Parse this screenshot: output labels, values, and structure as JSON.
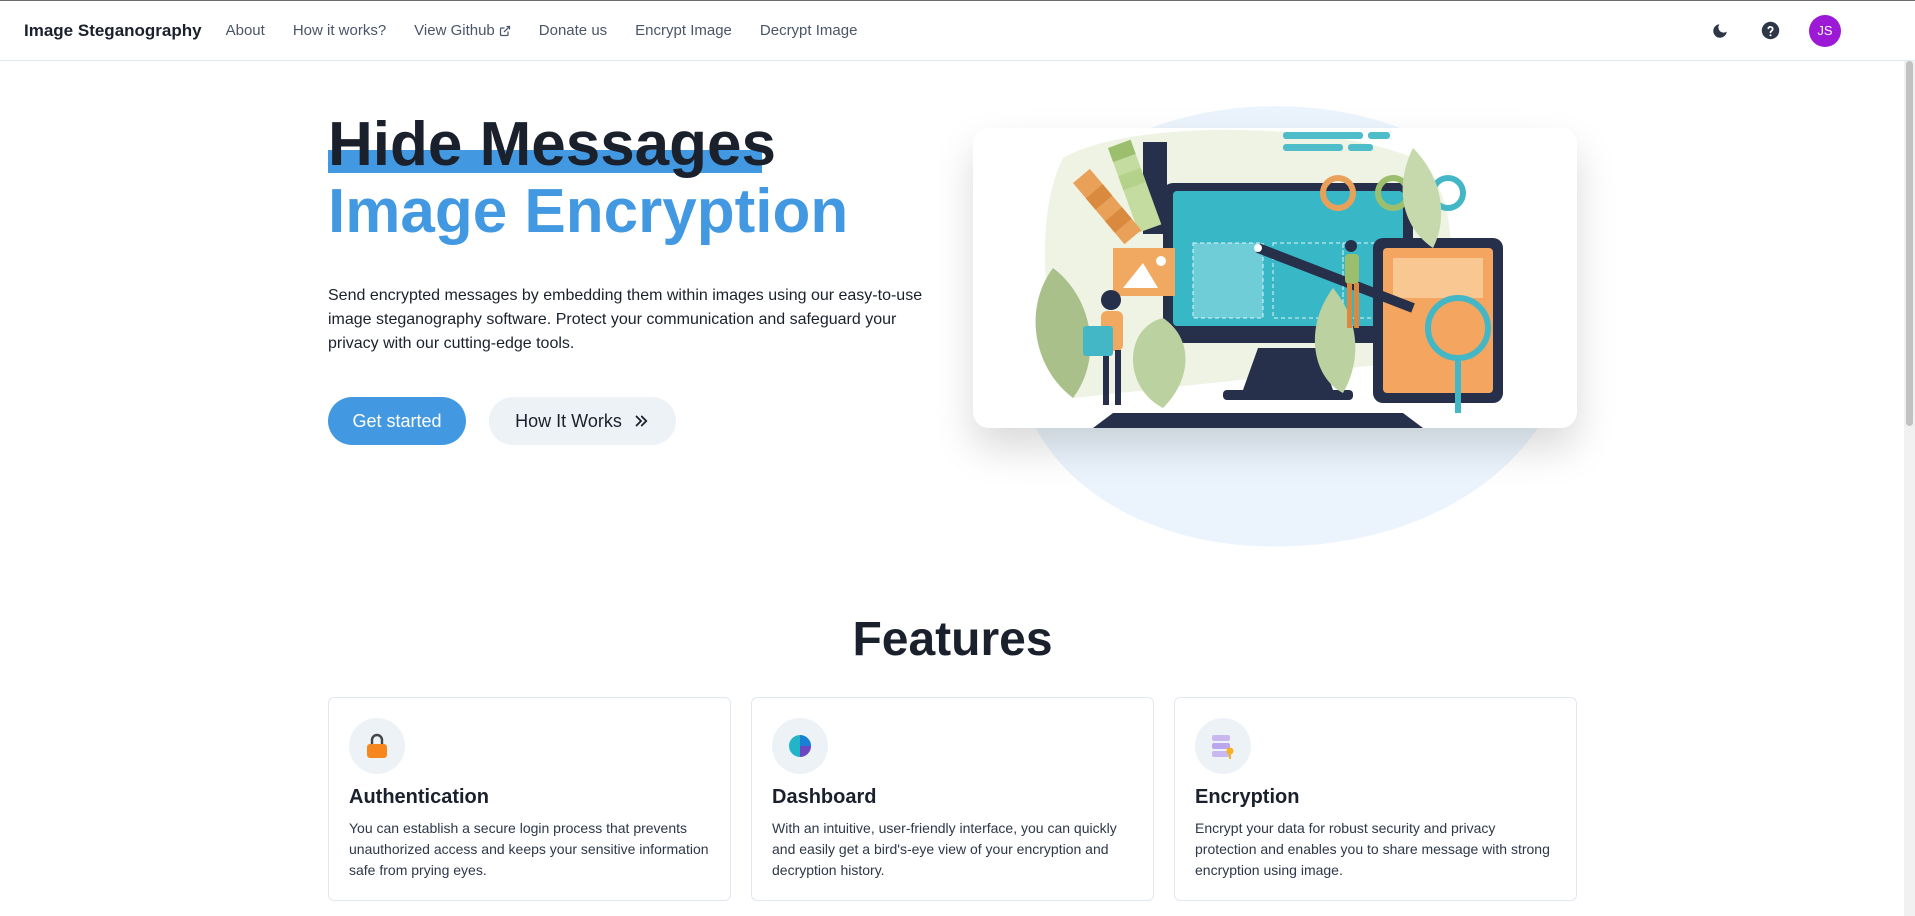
{
  "navbar": {
    "brand": "Image Steganography",
    "links": [
      "About",
      "How it works?",
      "View Github",
      "Donate us",
      "Encrypt Image",
      "Decrypt Image"
    ],
    "avatar_initials": "JS",
    "icons": [
      "moon-icon",
      "help-icon",
      "external-link-icon"
    ]
  },
  "hero": {
    "title_line1": "Hide Messages",
    "title_line2": "Image Encryption",
    "description": "Send encrypted messages by embedding them within images using our easy-to-use image steganography software. Protect your communication and safeguard your privacy with our cutting-edge tools.",
    "primary_button": "Get started",
    "secondary_button": "How It Works"
  },
  "features": {
    "title": "Features",
    "cards": [
      {
        "title": "Authentication",
        "text": "You can establish a secure login process that prevents unauthorized access and keeps your sensitive information safe from prying eyes.",
        "icon": "lock-icon"
      },
      {
        "title": "Dashboard",
        "text": "With an intuitive, user-friendly interface, you can quickly and easily get a bird's-eye view of your encryption and decryption history.",
        "icon": "pie-chart-icon"
      },
      {
        "title": "Encryption",
        "text": "Encrypt your data for robust security and privacy protection and enables you to share message with strong encryption using image.",
        "icon": "database-key-icon"
      }
    ]
  },
  "colors": {
    "accent": "#4299e1",
    "avatar": "#9c1ad6",
    "text": "#1a202c"
  }
}
